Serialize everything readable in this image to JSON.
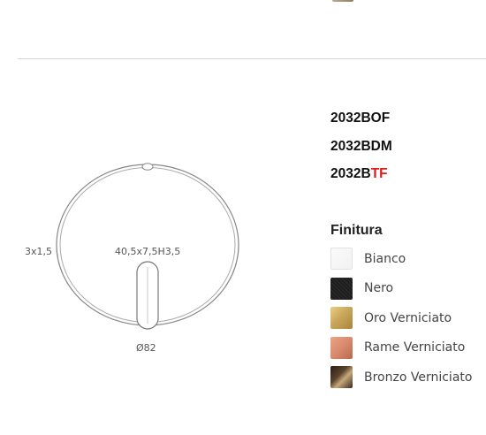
{
  "drawing": {
    "dim_thickness": "3x1,5",
    "dim_handle": "40,5x7,5H3,5",
    "dim_diameter": "Ø82"
  },
  "product_codes": {
    "code_1": "2032BOF",
    "code_2": "2032BDM",
    "code_3_prefix": "2032B",
    "code_3_suffix": "TF",
    "suffix_color": "#e01919"
  },
  "finitura": {
    "title": "Finitura",
    "options": [
      {
        "label": "Bianco",
        "swatch_icon": "white-swatch",
        "color": "#f2f2f2"
      },
      {
        "label": "Nero",
        "swatch_icon": "black-swatch",
        "color": "#1e1e1e"
      },
      {
        "label": "Oro Verniciato",
        "swatch_icon": "gold-swatch",
        "color": "#c9a75a"
      },
      {
        "label": "Rame Verniciato",
        "swatch_icon": "copper-swatch",
        "color": "#d98a6c"
      },
      {
        "label": "Bronzo Verniciato",
        "swatch_icon": "bronze-swatch",
        "color": "#5a4430"
      }
    ]
  }
}
